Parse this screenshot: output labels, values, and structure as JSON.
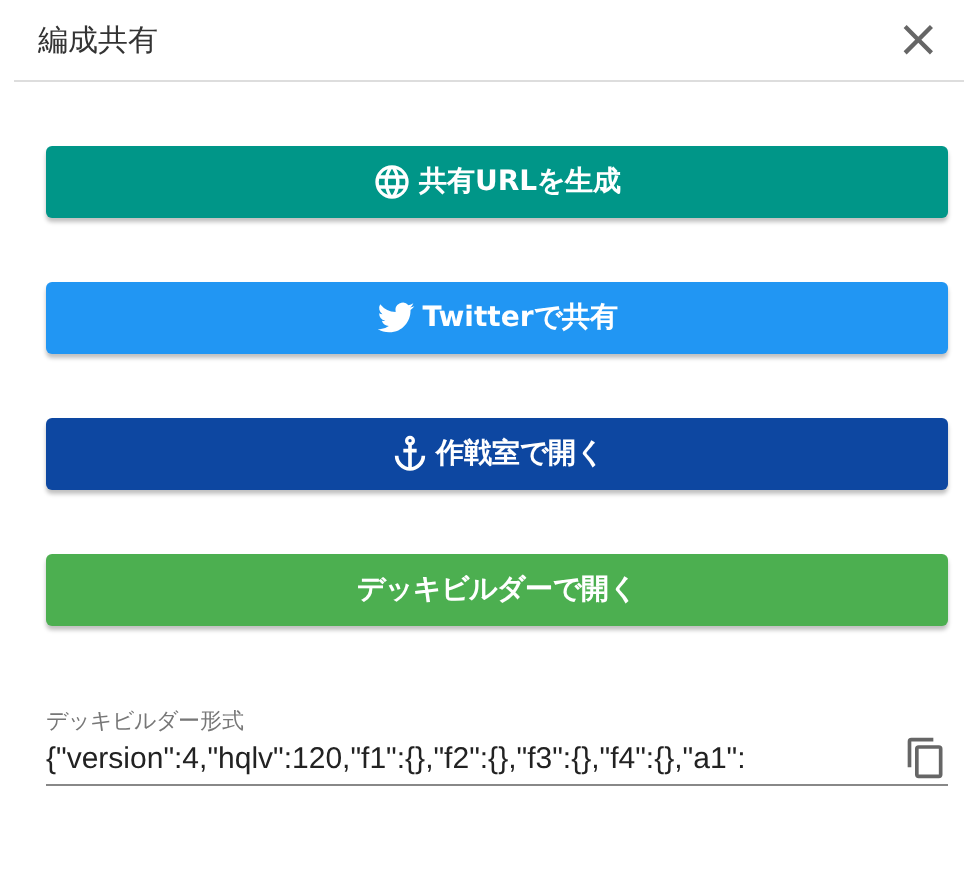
{
  "dialog": {
    "title": "編成共有",
    "close": "×"
  },
  "buttons": [
    {
      "label": "共有URLを生成",
      "kind": "globe",
      "color": "#009688"
    },
    {
      "label": "Twitterで共有",
      "kind": "bird",
      "color": "#2196f3"
    },
    {
      "label": "作戦室で開く",
      "kind": "anchor",
      "color": "#0d47a1"
    },
    {
      "label": "デッキビルダーで開く",
      "kind": "none",
      "color": "#4caf50"
    }
  ],
  "field": {
    "label": "デッキビルダー形式",
    "value": "{\"version\":4,\"hqlv\":120,\"f1\":{},\"f2\":{},\"f3\":{},\"f4\":{},\"a1\":"
  }
}
